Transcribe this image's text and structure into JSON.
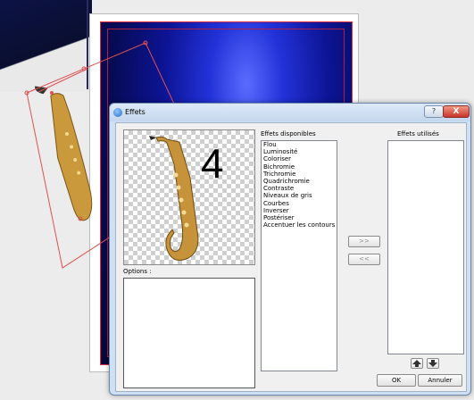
{
  "dialog": {
    "title": "Effets",
    "help_label": "?",
    "close_label": "X",
    "preview_number": "4",
    "options_label": "Options :",
    "available_label": "Effets disponibles",
    "available_effects": [
      "Flou",
      "Luminosité",
      "Coloriser",
      "Bichromie",
      "Trichromie",
      "Quadrichromie",
      "Contraste",
      "Niveaux de gris",
      "Courbes",
      "Inverser",
      "Postériser",
      "Accentuer les contours"
    ],
    "used_label": "Effets utilisés",
    "add_label": ">>",
    "remove_label": "<<",
    "up_icon": "up-arrow-icon",
    "down_icon": "down-arrow-icon",
    "ok_label": "OK",
    "cancel_label": "Annuler"
  },
  "colors": {
    "accent_selection": "#e05050",
    "title_bar": "#cfe0f2",
    "close_button": "#c8352a",
    "concert_blue": "#2232d8"
  }
}
